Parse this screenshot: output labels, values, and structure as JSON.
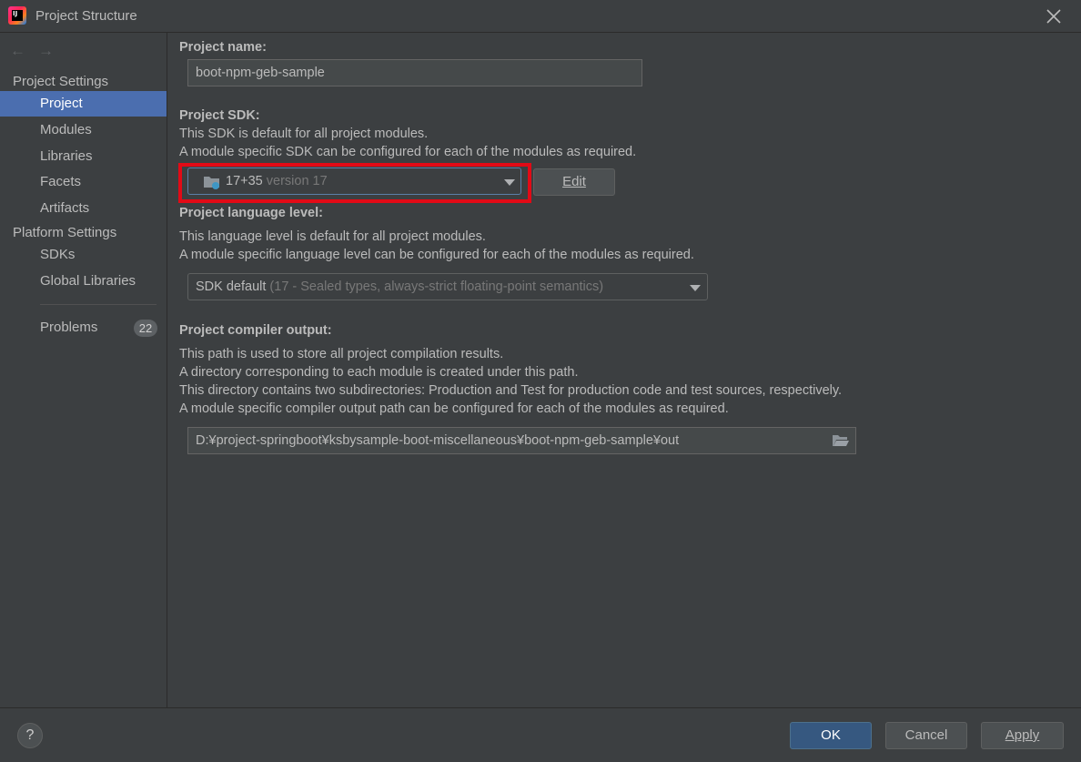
{
  "window": {
    "title": "Project Structure",
    "app_icon": "intellij-idea-icon",
    "app_icon_text": "IJ"
  },
  "sidebar": {
    "back_arrow": "←",
    "forward_arrow": "→",
    "groups": [
      {
        "label": "Project Settings",
        "items": [
          "Project",
          "Modules",
          "Libraries",
          "Facets",
          "Artifacts"
        ]
      },
      {
        "label": "Platform Settings",
        "items": [
          "SDKs",
          "Global Libraries"
        ]
      }
    ],
    "selected_item": "Project",
    "problems": {
      "label": "Problems",
      "count": "22"
    }
  },
  "project": {
    "name_label": "Project name:",
    "name_value": "boot-npm-geb-sample",
    "sdk_label": "Project SDK:",
    "sdk_desc_1": "This SDK is default for all project modules.",
    "sdk_desc_2": "A module specific SDK can be configured for each of the modules as required.",
    "sdk_value": "17+35",
    "sdk_version_hint": "version 17",
    "sdk_icon": "folder-sdk-icon",
    "edit_button": "Edit",
    "lang_label": "Project language level:",
    "lang_desc_1": "This language level is default for all project modules.",
    "lang_desc_2": "A module specific language level can be configured for each of the modules as required.",
    "lang_value": "SDK default",
    "lang_hint": "(17 - Sealed types, always-strict floating-point semantics)",
    "output_label": "Project compiler output:",
    "output_desc_1": "This path is used to store all project compilation results.",
    "output_desc_2": "A directory corresponding to each module is created under this path.",
    "output_desc_3": "This directory contains two subdirectories: Production and Test for production code and test sources, respectively.",
    "output_desc_4": "A module specific compiler output path can be configured for each of the modules as required.",
    "output_path": "D:¥project-springboot¥ksbysample-boot-miscellaneous¥boot-npm-geb-sample¥out"
  },
  "footer": {
    "help": "?",
    "ok": "OK",
    "cancel": "Cancel",
    "apply": "Apply"
  },
  "colors": {
    "background": "#3c3f41",
    "selection": "#4b6eaf",
    "primary_button": "#365880",
    "annotation": "#e20a16"
  }
}
